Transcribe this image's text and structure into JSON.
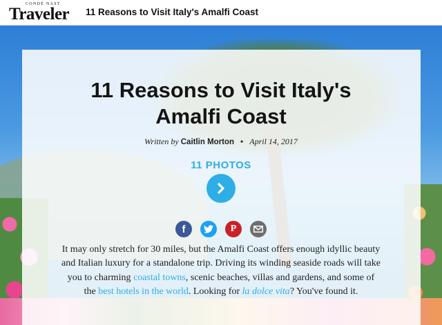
{
  "header": {
    "logo_small": "CONDÉ NAST",
    "logo_main": "Traveler",
    "title": "11 Reasons to Visit Italy's Amalfi Coast"
  },
  "article": {
    "headline_line1": "11 Reasons to Visit Italy's",
    "headline_line2": "Amalfi Coast",
    "byline_label": "Written by",
    "author": "Caitlin Morton",
    "separator": "•",
    "date": "April 14, 2017",
    "photos_label": "11 PHOTOS",
    "next_icon": "chevron-right-icon"
  },
  "share": {
    "facebook_label": "f",
    "twitter_icon": "twitter-bird-icon",
    "pinterest_label": "P",
    "email_icon": "envelope-icon",
    "colors": {
      "facebook": "#3b5998",
      "twitter": "#1da1f2",
      "pinterest": "#cb2027",
      "email": "#6d6d6d"
    }
  },
  "body": {
    "t1": "It may only stretch for 30 miles, but the Amalfi Coast offers enough idyllic beauty and Italian luxury for a standalone trip. Driving its winding seaside roads will take you to charming ",
    "link1": "coastal towns",
    "t2": ", scenic beaches, villas and gardens, and some of the ",
    "link2": "best hotels in the world",
    "t3": ". Looking for ",
    "link3": "la dolce vita",
    "t4": "? You've found it."
  },
  "colors": {
    "accent": "#2eaee6"
  }
}
